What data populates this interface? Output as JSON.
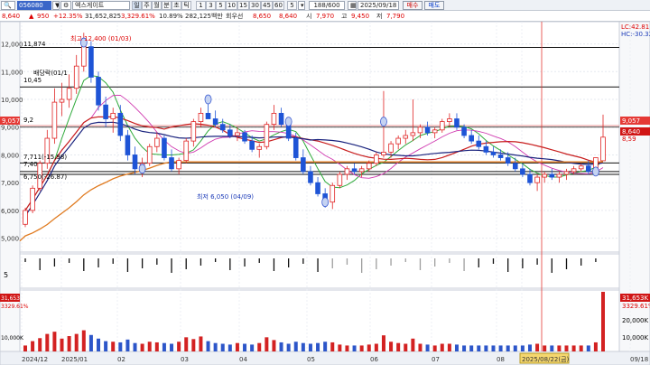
{
  "toolbar": {
    "icon1": "search-icon",
    "icon2": "lock-icon",
    "code": "056080",
    "stock_name": "엑스게이트",
    "periods": [
      "주",
      "월",
      "분",
      "초",
      "틱"
    ],
    "intervals": [
      "1",
      "3",
      "5",
      "10",
      "15",
      "30",
      "45",
      "60",
      "5"
    ],
    "counter": "188/600",
    "date": "2025/09/18",
    "buy_label": "매수",
    "sell_label": "매도"
  },
  "quote": {
    "price": "8,640",
    "change": "950",
    "change_pct": "+12.35%",
    "volume": "31,652,825",
    "vol_ratio": "3,329.61%",
    "turnover_ratio": "10.89%",
    "value": "282,125백만",
    "ticks": "회우선",
    "open_label": "",
    "open": "8,650",
    "current": "8,640",
    "high_label": "시",
    "high": "7,970",
    "low_label": "고",
    "low": "9,450",
    "close_label": "저",
    "close": "7,790"
  },
  "chart": {
    "y_axis": [
      "12,000",
      "11,000",
      "10,000",
      "9,000",
      "8,000",
      "7,000",
      "6,000",
      "5,000"
    ],
    "x_axis": [
      "2024/12",
      "2025/01",
      "02",
      "03",
      "04",
      "05",
      "06",
      "07",
      "08",
      "2025/08/22(금)",
      "09/18"
    ],
    "annotations": {
      "high": "최고 12,400 (01/03)",
      "low": "최저 6,050 (04/09)",
      "h1": "11,874",
      "h2": "10,45",
      "h3": "9,2",
      "l1": "7,711(-15.98)",
      "l2": "7,40",
      "l3": "6,750(-26.87)",
      "bd": "배당락(01/1"
    },
    "right_labels": {
      "lc": "LC:42.81",
      "hc": "HC:-30.32",
      "p1": "9,057",
      "p2": "8,640",
      "p3": "8,59"
    },
    "left_label": "9,057",
    "macd_label": "5",
    "volume_labels": {
      "v1": "31,653K",
      "v2": "3329.61%",
      "v3": "20,000K",
      "v4": "10,000K"
    },
    "volume_left": {
      "v1": "31,653K",
      "v2": "3329.61%",
      "v3": "10,000K"
    }
  },
  "chart_data": {
    "type": "candlestick",
    "y_range": [
      4500,
      12800
    ],
    "candles": [
      [
        5500,
        6100,
        5400,
        6000
      ],
      [
        6000,
        6900,
        5900,
        6800
      ],
      [
        6800,
        7800,
        6700,
        7700
      ],
      [
        7700,
        8900,
        7500,
        8600
      ],
      [
        8600,
        10400,
        8400,
        9900
      ],
      [
        9900,
        10600,
        9400,
        10000
      ],
      [
        10000,
        10900,
        9700,
        10400
      ],
      [
        10400,
        11600,
        10200,
        11200
      ],
      [
        11200,
        12400,
        11000,
        11900
      ],
      [
        11900,
        12100,
        10600,
        10800
      ],
      [
        10800,
        11000,
        9600,
        9800
      ],
      [
        9800,
        10100,
        9000,
        9300
      ],
      [
        9300,
        9700,
        8800,
        9500
      ],
      [
        9500,
        9800,
        8500,
        8700
      ],
      [
        8700,
        8900,
        7800,
        8000
      ],
      [
        8000,
        8300,
        7300,
        7500
      ],
      [
        7500,
        7900,
        7200,
        7700
      ],
      [
        7700,
        8400,
        7600,
        8300
      ],
      [
        8300,
        8800,
        8100,
        8600
      ],
      [
        8600,
        8700,
        7800,
        7900
      ],
      [
        7900,
        8200,
        7400,
        7500
      ],
      [
        7500,
        7900,
        7300,
        7800
      ],
      [
        7800,
        8600,
        7700,
        8500
      ],
      [
        8500,
        9300,
        8300,
        9200
      ],
      [
        9200,
        9700,
        9000,
        9500
      ],
      [
        9500,
        10100,
        9300,
        9300
      ],
      [
        9300,
        9600,
        9000,
        9100
      ],
      [
        9100,
        9300,
        8800,
        8900
      ],
      [
        8900,
        9100,
        8600,
        8700
      ],
      [
        8700,
        9000,
        8500,
        8800
      ],
      [
        8800,
        8900,
        8400,
        8500
      ],
      [
        8500,
        8700,
        8100,
        8200
      ],
      [
        8200,
        8400,
        7900,
        8300
      ],
      [
        8300,
        9200,
        8200,
        9100
      ],
      [
        9100,
        9800,
        8900,
        9500
      ],
      [
        9500,
        9700,
        9000,
        9100
      ],
      [
        9100,
        9300,
        8500,
        8600
      ],
      [
        8600,
        8800,
        7800,
        7900
      ],
      [
        7900,
        8200,
        7300,
        7400
      ],
      [
        7400,
        7600,
        6900,
        7000
      ],
      [
        7000,
        7200,
        6500,
        6600
      ],
      [
        6600,
        6800,
        6100,
        6300
      ],
      [
        6300,
        7000,
        6050,
        6900
      ],
      [
        6900,
        7400,
        6800,
        7300
      ],
      [
        7300,
        7600,
        7100,
        7500
      ],
      [
        7500,
        7700,
        7300,
        7400
      ],
      [
        7400,
        7600,
        7200,
        7500
      ],
      [
        7500,
        7800,
        7400,
        7700
      ],
      [
        7700,
        8100,
        7600,
        8000
      ],
      [
        8000,
        10300,
        7900,
        8100
      ],
      [
        8100,
        8500,
        7900,
        8400
      ],
      [
        8400,
        8700,
        8200,
        8600
      ],
      [
        8600,
        8900,
        8400,
        8700
      ],
      [
        8700,
        10000,
        8500,
        8800
      ],
      [
        8800,
        9100,
        8600,
        9000
      ],
      [
        9000,
        9200,
        8700,
        8800
      ],
      [
        8800,
        9000,
        8600,
        8900
      ],
      [
        8900,
        9300,
        8800,
        9200
      ],
      [
        9200,
        9500,
        9000,
        9300
      ],
      [
        9300,
        9500,
        8900,
        9000
      ],
      [
        9000,
        9100,
        8600,
        8700
      ],
      [
        8700,
        8900,
        8400,
        8500
      ],
      [
        8500,
        8700,
        8200,
        8300
      ],
      [
        8300,
        8500,
        8000,
        8100
      ],
      [
        8100,
        8300,
        7900,
        8000
      ],
      [
        8000,
        8200,
        7800,
        7900
      ],
      [
        7900,
        8100,
        7600,
        7700
      ],
      [
        7700,
        7900,
        7400,
        7500
      ],
      [
        7500,
        7700,
        7200,
        7300
      ],
      [
        7300,
        7500,
        6900,
        7000
      ],
      [
        7000,
        7300,
        6700,
        7200
      ],
      [
        7200,
        7400,
        7000,
        7300
      ],
      [
        7300,
        7500,
        7100,
        7200
      ],
      [
        7200,
        7400,
        7000,
        7300
      ],
      [
        7300,
        7500,
        7100,
        7400
      ],
      [
        7400,
        7600,
        7300,
        7500
      ],
      [
        7500,
        7700,
        7400,
        7600
      ],
      [
        7600,
        7800,
        7300,
        7400
      ],
      [
        7400,
        7900,
        7300,
        7900
      ],
      [
        7790,
        9450,
        7790,
        8640
      ]
    ],
    "volumes": [
      300,
      900,
      1500,
      2600,
      3300,
      1400,
      2000,
      2600,
      3800,
      2300,
      1400,
      900,
      800,
      700,
      1200,
      600,
      500,
      800,
      700,
      600,
      500,
      800,
      1700,
      1300,
      1900,
      900,
      600,
      500,
      400,
      600,
      500,
      400,
      600,
      1700,
      1100,
      700,
      500,
      800,
      600,
      500,
      600,
      800,
      700,
      400,
      300,
      300,
      300,
      400,
      500,
      2200,
      800,
      600,
      500,
      1400,
      500,
      400,
      300,
      500,
      500,
      400,
      300,
      300,
      300,
      300,
      300,
      300,
      300,
      300,
      300,
      400,
      500,
      300,
      300,
      300,
      300,
      300,
      300,
      300,
      700,
      31653
    ],
    "volume_range": [
      0,
      32000
    ]
  }
}
